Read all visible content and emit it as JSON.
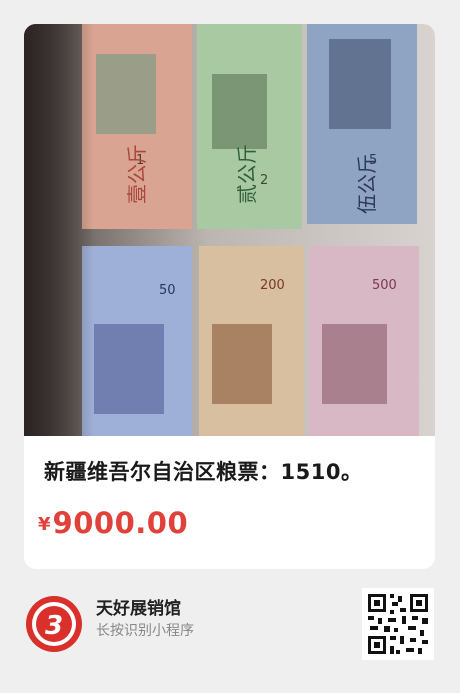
{
  "product": {
    "title": "新疆维吾尔自治区粮票：1510。",
    "currency_symbol": "¥",
    "price": "9000.00",
    "price_color": "#e0413a"
  },
  "shop": {
    "name": "天好展销馆",
    "hint": "长按识别小程序",
    "logo_icon": "shop-logo-3",
    "qr_icon": "mini-program-qr-code"
  },
  "photo": {
    "description_icon": "grain-ticket-photo",
    "notes_top": [
      {
        "denomination": "1",
        "amount_text": "壹公斤",
        "color": "#d9a592"
      },
      {
        "denomination": "2",
        "amount_text": "贰公斤",
        "color": "#a9c9a2"
      },
      {
        "denomination": "5",
        "amount_text": "伍公斤",
        "color": "#8fa3c3"
      }
    ],
    "notes_bottom": [
      {
        "denomination": "50",
        "color": "#9fb0d8"
      },
      {
        "denomination": "200",
        "color": "#d8bfa0"
      },
      {
        "denomination": "500",
        "color": "#d8b8c4"
      }
    ]
  }
}
